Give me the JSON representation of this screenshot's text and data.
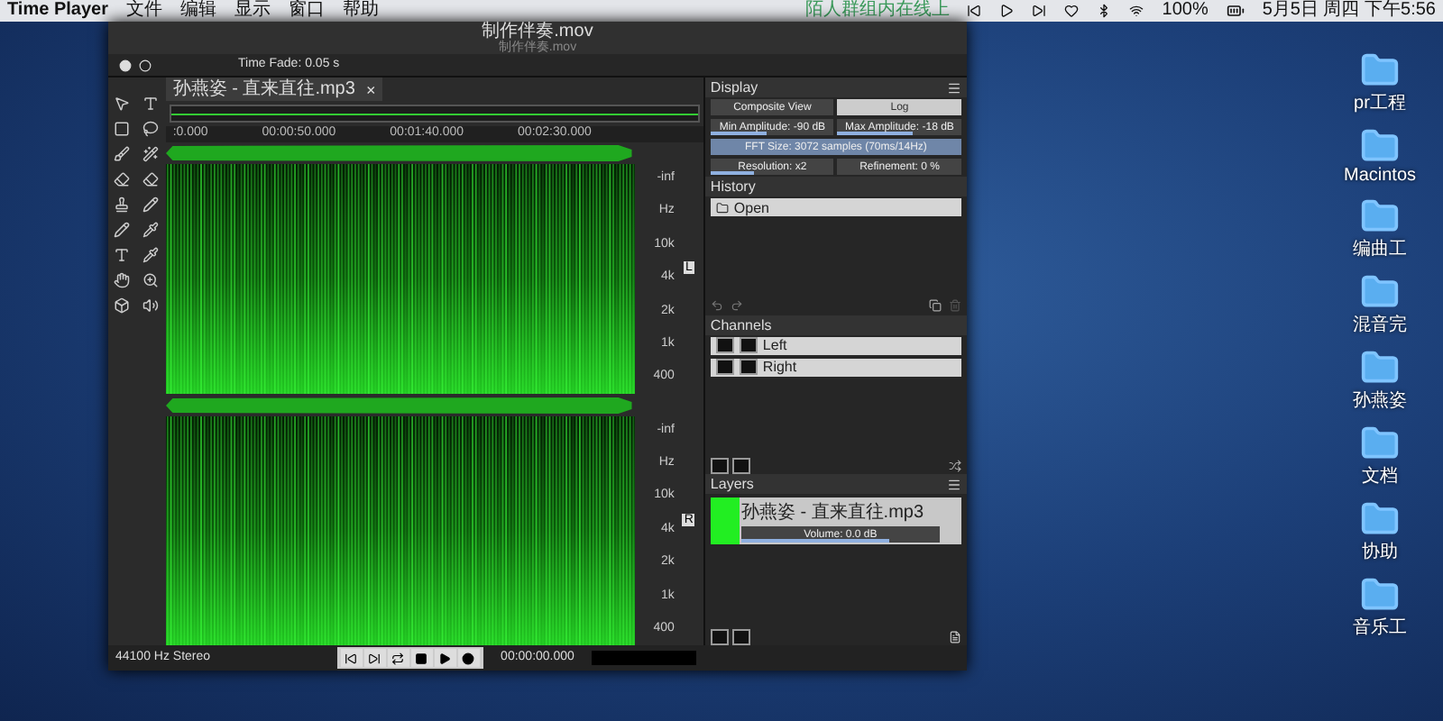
{
  "menubar": {
    "app": "Time Player",
    "items": [
      "文件",
      "编辑",
      "显示",
      "窗口",
      "帮助"
    ],
    "status_text": "陌人群组内在线上",
    "battery": "100%",
    "clock": "5月5日 周四 下午5:56"
  },
  "window": {
    "title": "制作伴奏.mov",
    "subtitle": "制作伴奏.mov"
  },
  "toolbar": {
    "time_fade": "Time Fade: 0.05 s"
  },
  "file_tab": {
    "label": "孙燕姿 - 直来直往.mp3",
    "close": "×"
  },
  "timeline": {
    "ticks": [
      ":0.000",
      "00:00:50.000",
      "00:01:40.000",
      "00:02:30.000"
    ]
  },
  "channels_view": [
    {
      "name": "L",
      "freq_labels": [
        "10k",
        "4k",
        "2k",
        "1k",
        "400"
      ],
      "inf": "-inf",
      "unit": "Hz"
    },
    {
      "name": "R",
      "freq_labels": [
        "10k",
        "4k",
        "2k",
        "1k",
        "400"
      ],
      "inf": "-inf",
      "unit": "Hz"
    }
  ],
  "display": {
    "title": "Display",
    "view": "Composite View",
    "scale": "Log",
    "min_amp": {
      "label": "Min Amplitude: -90 dB",
      "level": 0.45
    },
    "max_amp": {
      "label": "Max Amplitude: -18 dB",
      "level": 0.6
    },
    "fft": "FFT Size: 3072 samples (70ms/14Hz)",
    "resolution": {
      "label": "Resolution: x2",
      "level": 0.35
    },
    "refinement": "Refinement: 0 %"
  },
  "history": {
    "title": "History",
    "items": [
      {
        "label": "Open",
        "selected": true
      }
    ]
  },
  "channels": {
    "title": "Channels",
    "items": [
      {
        "label": "Left"
      },
      {
        "label": "Right"
      }
    ]
  },
  "layers": {
    "title": "Layers",
    "items": [
      {
        "name": "孙燕姿 - 直来直往.mp3",
        "volume": "Volume: 0.0 dB",
        "level": 0.75
      }
    ]
  },
  "status": {
    "format": "44100 Hz Stereo",
    "time": "00:00:00.000"
  },
  "desktop": [
    "pr工程",
    "Macintos",
    "编曲工",
    "混音完",
    "孙燕姿",
    "文档",
    "协助",
    "音乐工"
  ]
}
